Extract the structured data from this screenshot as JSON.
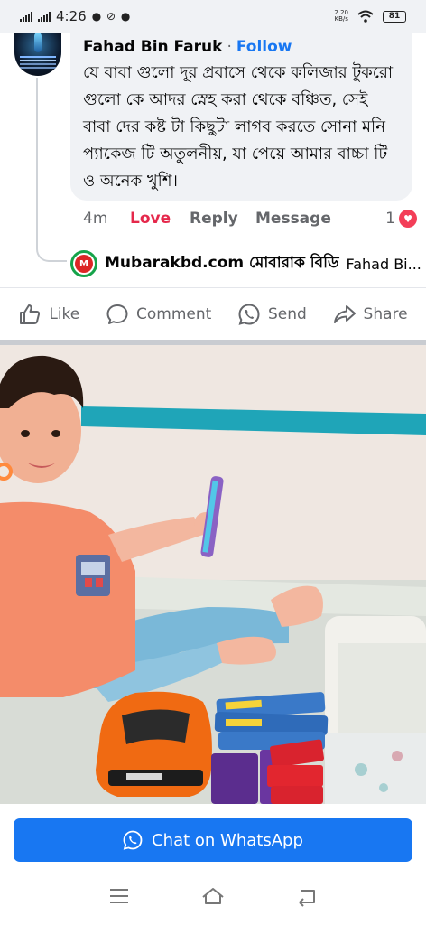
{
  "status_bar": {
    "time": "4:26",
    "net_speed_value": "2.20",
    "net_speed_unit": "KB/s",
    "battery": "81"
  },
  "comment": {
    "author": "Fahad Bin Faruk",
    "separator": "·",
    "follow_label": "Follow",
    "text": "যে বাবা গুলো দূর প্রবাসে থেকে কলিজার টুকরো গুলো কে আদর স্নেহ করা থেকে বঞ্চিত, সেই বাবা দের কষ্ট টা কিছুটা লাগব করতে সোনা মনি প্যাকেজ টি অতুলনীয়, যা পেয়ে আমার বাচ্চা টি ও অনেক খুশি।",
    "time_ago": "4m",
    "love_label": "Love",
    "reply_label": "Reply",
    "message_label": "Message",
    "reaction_count": "1"
  },
  "reply": {
    "page_name": "Mubarakbd.com মোবারাক বিডি",
    "snippet": "Fahad Bi..."
  },
  "post_actions": {
    "like": "Like",
    "comment": "Comment",
    "send": "Send",
    "share": "Share"
  },
  "whatsapp": {
    "label": "Chat on WhatsApp"
  },
  "colors": {
    "accent": "#1877f2",
    "love": "#e5284b",
    "heart": "#f33e58"
  }
}
